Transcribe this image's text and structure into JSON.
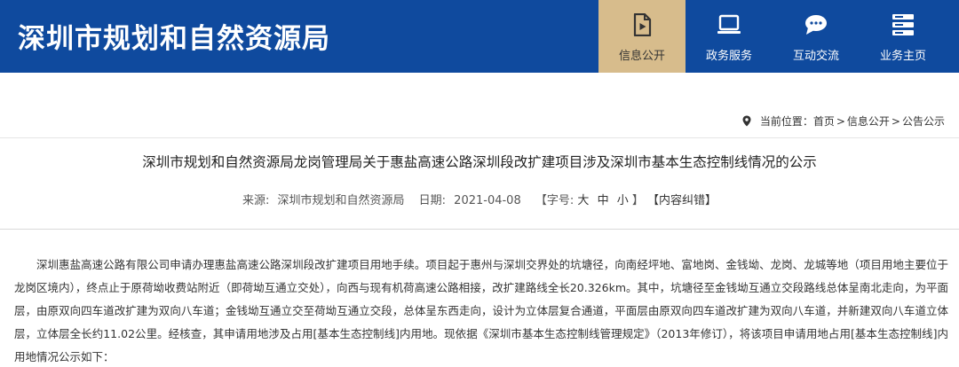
{
  "header": {
    "site_title": "深圳市规划和自然资源局",
    "nav": [
      {
        "label": "信息公开",
        "icon": "document-icon",
        "active": true
      },
      {
        "label": "政务服务",
        "icon": "monitor-icon",
        "active": false
      },
      {
        "label": "互动交流",
        "icon": "chat-bubble-icon",
        "active": false
      },
      {
        "label": "业务主页",
        "icon": "server-stack-icon",
        "active": false
      }
    ],
    "colors": {
      "background": "#0f4a9e",
      "active_tab": "#d7bc8c"
    }
  },
  "breadcrumb": {
    "prefix": "当前位置：",
    "items": [
      "首页",
      "信息公开",
      "公告公示"
    ],
    "separator": ">"
  },
  "article": {
    "title": "深圳市规划和自然资源局龙岗管理局关于惠盐高速公路深圳段改扩建项目涉及深圳市基本生态控制线情况的公示",
    "meta": {
      "source_label": "来源:",
      "source": "深圳市规划和自然资源局",
      "date_label": "日期:",
      "date": "2021-04-08",
      "font_size_label": "【字号:",
      "sizes": [
        "大",
        "中",
        "小"
      ],
      "font_size_close": "】",
      "correction": "【内容纠错】"
    },
    "body": "深圳惠盐高速公路有限公司申请办理惠盐高速公路深圳段改扩建项目用地手续。项目起于惠州与深圳交界处的坑塘径，向南经坪地、富地岗、金钱坳、龙岗、龙城等地（项目用地主要位于龙岗区境内），终点止于原荷坳收费站附近（即荷坳互通立交处），向西与现有机荷高速公路相接，改扩建路线全长20.326km。其中，坑塘径至金钱坳互通立交段路线总体呈南北走向，为平面层，由原双向四车道改扩建为双向八车道；金钱坳互通立交至荷坳互通立交段，总体呈东西走向，设计为立体层复合通道，平面层由原双向四车道改扩建为双向八车道，并新建双向八车道立体层，立体层全长约11.02公里。经核查，其申请用地涉及占用[基本生态控制线]内用地。现依据《深圳市基本生态控制线管理规定》（2013年修订），将该项目申请用地占用[基本生态控制线]内用地情况公示如下："
  }
}
